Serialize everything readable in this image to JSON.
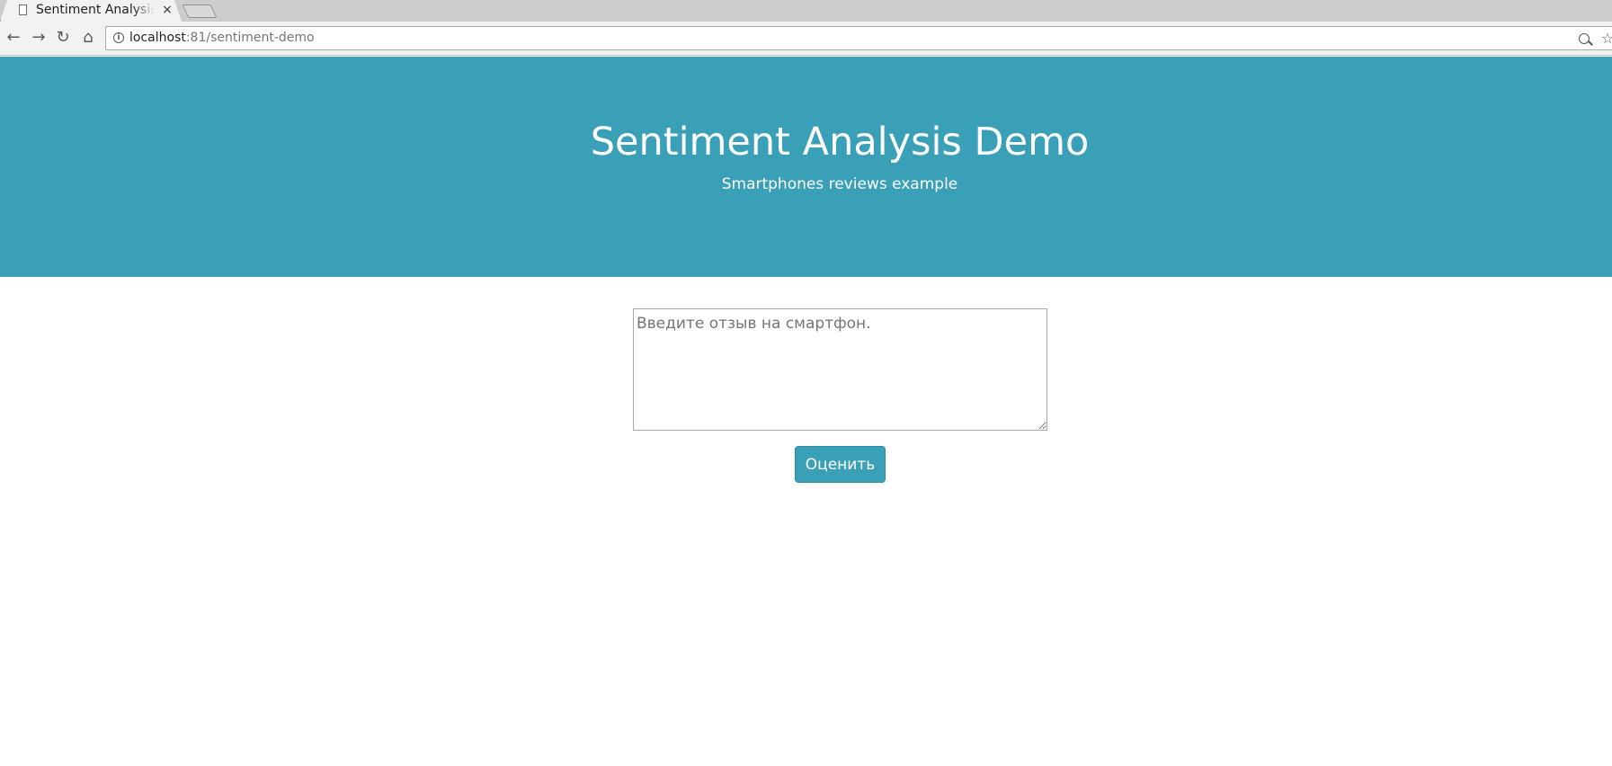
{
  "browser": {
    "tab": {
      "title": "Sentiment Analysis Demo",
      "close_glyph": "×",
      "icon": "page-icon"
    },
    "toolbar": {
      "back_glyph": "←",
      "forward_glyph": "→",
      "reload_glyph": "↻",
      "home_glyph": "⌂",
      "info_glyph": "i",
      "url_host": "localhost",
      "url_rest": ":81/sentiment-demo",
      "zoom_icon": "zoom-icon",
      "star_glyph": "☆"
    }
  },
  "hero": {
    "title": "Sentiment Analysis Demo",
    "subtitle": "Smartphones reviews example",
    "background_color": "#39a0b7"
  },
  "form": {
    "review_placeholder": "Введите отзыв на смартфон.",
    "review_value": "",
    "submit_label": "Оценить",
    "accent_color": "#39a0b7"
  }
}
